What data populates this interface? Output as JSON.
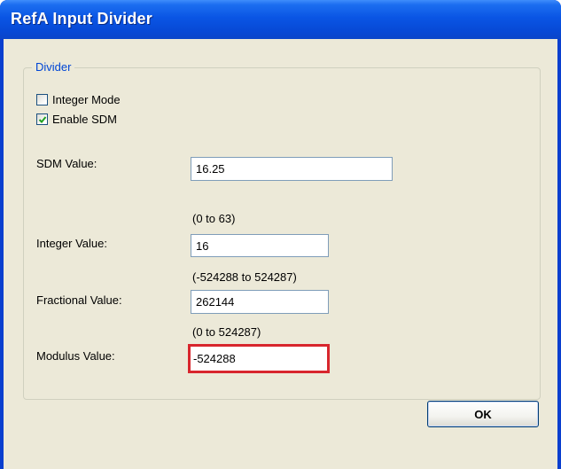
{
  "window": {
    "title": "RefA Input Divider"
  },
  "group": {
    "legend": "Divider"
  },
  "checkboxes": {
    "integer_mode": {
      "label": "Integer Mode",
      "checked": false
    },
    "enable_sdm": {
      "label": "Enable SDM",
      "checked": true
    }
  },
  "fields": {
    "sdm": {
      "label": "SDM Value:",
      "value": "16.25"
    },
    "integer": {
      "label": "Integer Value:",
      "range": "(0 to 63)",
      "value": "16"
    },
    "fractional": {
      "label": "Fractional Value:",
      "range": "(-524288 to 524287)",
      "value": "262144"
    },
    "modulus": {
      "label": "Modulus Value:",
      "range": "(0 to 524287)",
      "value": "-524288",
      "error_border_color": "#d8262d"
    }
  },
  "buttons": {
    "ok_label": "OK"
  },
  "colors": {
    "titlebar": "#0a55e4",
    "client_bg": "#ece9d8",
    "legend_text": "#0046d5",
    "checkmark": "#21a121"
  }
}
